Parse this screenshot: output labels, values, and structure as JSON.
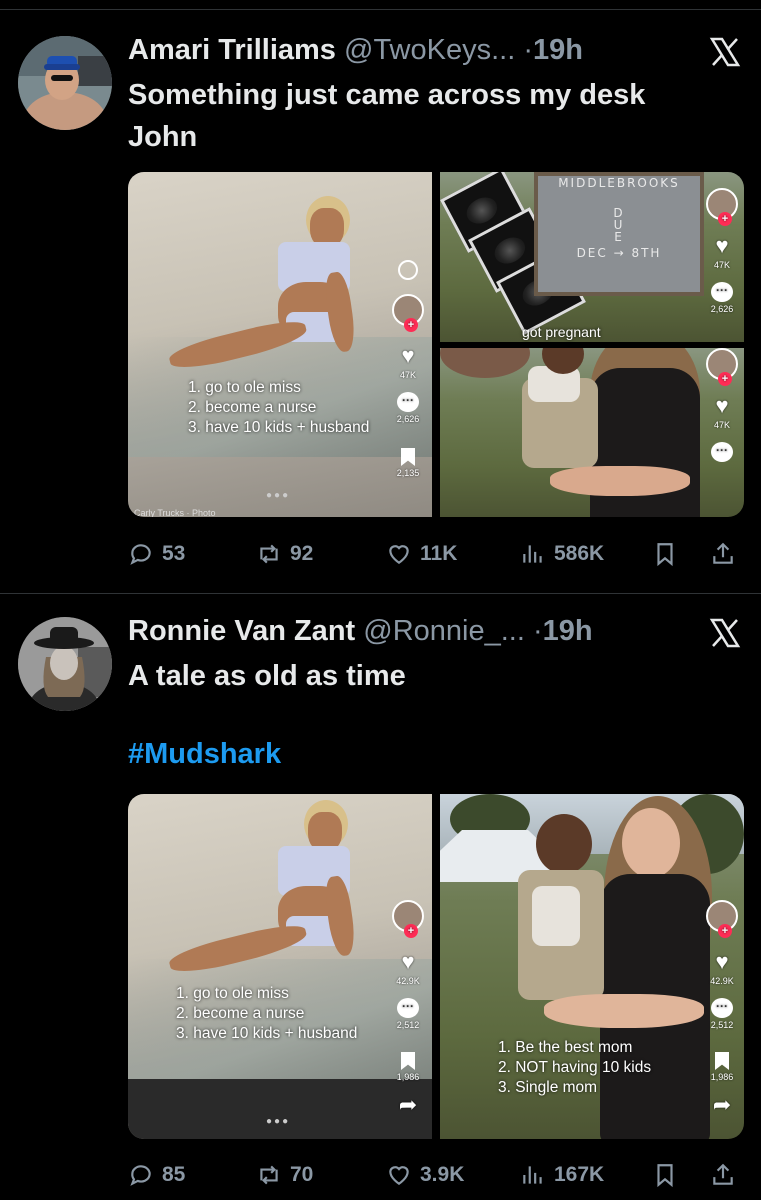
{
  "tweets": [
    {
      "name": "Amari Trilliams",
      "handle": "@TwoKeys...",
      "dot": "·",
      "time": "19h",
      "text_lines": [
        "Something just came across my desk",
        "John"
      ],
      "media": {
        "left": {
          "list": [
            "1. go to ole miss",
            "2. become a nurse",
            "3. have 10 kids + husband"
          ],
          "likes": "47K",
          "comments": "2,626",
          "saves": "2,135",
          "tag": "Carly Trucks · Photo"
        },
        "top_right": {
          "board_lines": [
            "MIDDLEBROOKS",
            "D",
            "U",
            "E",
            "DEC → 8TH"
          ],
          "caption": "got pregnant",
          "likes": "47K",
          "comments": "2,626"
        },
        "bottom_right": {
          "likes": "47K"
        }
      },
      "stats": {
        "replies": "53",
        "reposts": "92",
        "likes": "11K",
        "views": "586K"
      }
    },
    {
      "name": "Ronnie Van Zant",
      "handle": "@Ronnie_...",
      "dot": "·",
      "time": "19h",
      "text_lines": [
        "A tale as old as time"
      ],
      "hashtag": "#Mudshark",
      "media": {
        "left": {
          "list": [
            "1. go to ole miss",
            "2. become a nurse",
            "3. have 10 kids + husband"
          ],
          "likes": "42.9K",
          "comments": "2,512",
          "saves": "1,986"
        },
        "right": {
          "list": [
            "1. Be the best mom",
            "2. NOT having 10 kids",
            "3. Single mom"
          ],
          "likes": "42.9K",
          "comments": "2,512",
          "saves": "1,986"
        }
      },
      "stats": {
        "replies": "85",
        "reposts": "70",
        "likes": "3.9K",
        "views": "167K"
      }
    }
  ],
  "icons": {
    "reply": "reply-icon",
    "repost": "repost-icon",
    "like": "heart-icon",
    "views": "views-icon",
    "bookmark": "bookmark-icon",
    "share": "share-icon",
    "logo": "x-logo-icon"
  },
  "colors": {
    "background": "#000000",
    "text": "#e7e9ea",
    "muted": "#8b98a5",
    "link": "#1d9bf0",
    "divider": "#2f3336"
  }
}
